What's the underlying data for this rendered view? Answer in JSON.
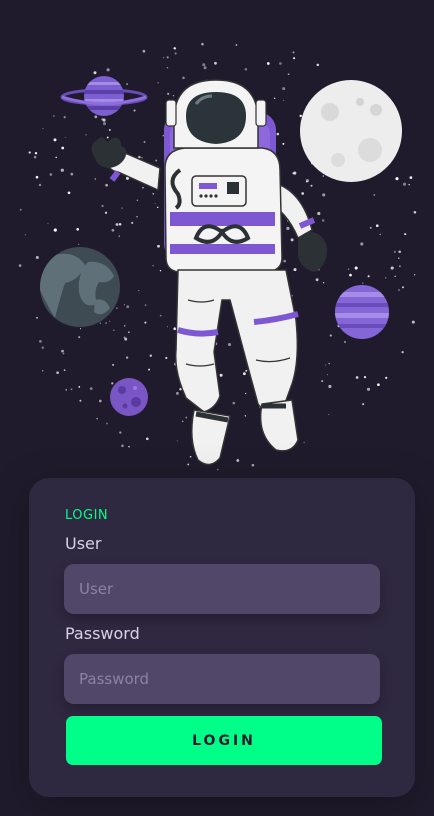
{
  "hero": {
    "illustration": "astronaut-floating-in-space",
    "colors": {
      "background": "#201b2c",
      "planet_purple": "#7b5cc8",
      "moon": "#eeeeee",
      "earth": "#3d4a52",
      "suit": "#f2f2f2",
      "accent": "#7d5bd1"
    }
  },
  "login": {
    "heading": "LOGIN",
    "user_label": "User",
    "user_placeholder": "User",
    "password_label": "Password",
    "password_placeholder": "Password",
    "button_label": "LOGIN"
  },
  "theme": {
    "page_bg": "#201b2c",
    "card_bg": "#2f2841",
    "input_bg": "#514869",
    "accent": "#00ff88"
  }
}
